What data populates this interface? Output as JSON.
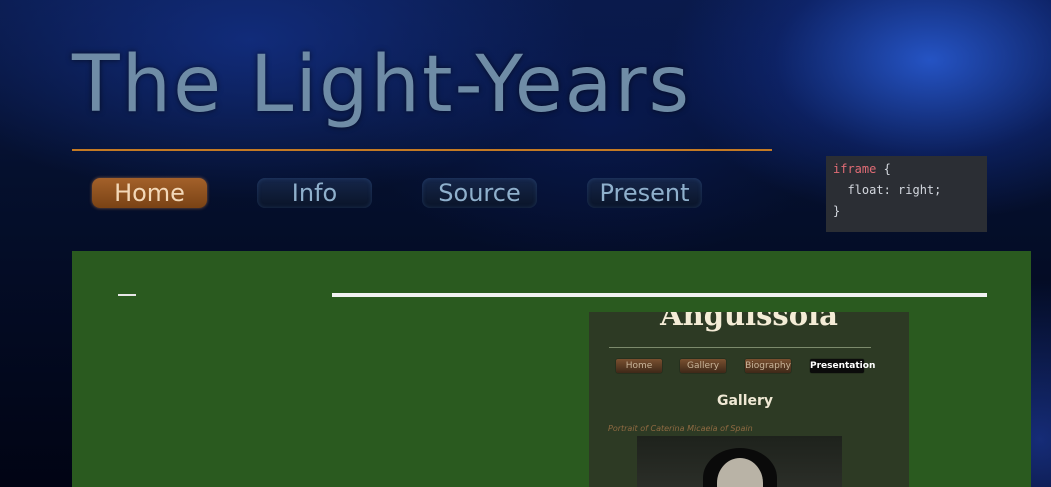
{
  "header": {
    "title": "The Light-Years"
  },
  "nav": {
    "items": [
      {
        "label": "Home",
        "active": true
      },
      {
        "label": "Info",
        "active": false
      },
      {
        "label": "Source",
        "active": false
      },
      {
        "label": "Present",
        "active": false
      }
    ]
  },
  "code": {
    "selector": "iframe",
    "open_brace": "{",
    "property_line": "  float: right;",
    "close_brace": "}"
  },
  "content": {
    "dash": "—"
  },
  "embedded": {
    "title": "Anguissola",
    "nav": [
      {
        "label": "Home",
        "active": false
      },
      {
        "label": "Gallery",
        "active": false
      },
      {
        "label": "Biography",
        "active": false
      },
      {
        "label": "Presentation",
        "active": true
      }
    ],
    "heading": "Gallery",
    "caption": "Portrait of Caterina Micaela of Spain"
  },
  "colors": {
    "title": "#6f8ca6",
    "title_rule": "#c47a24",
    "active_nav": "#a3612a",
    "panel": "#2a5a1f",
    "code_bg": "#2b2e34",
    "code_keyword": "#e06c75"
  }
}
